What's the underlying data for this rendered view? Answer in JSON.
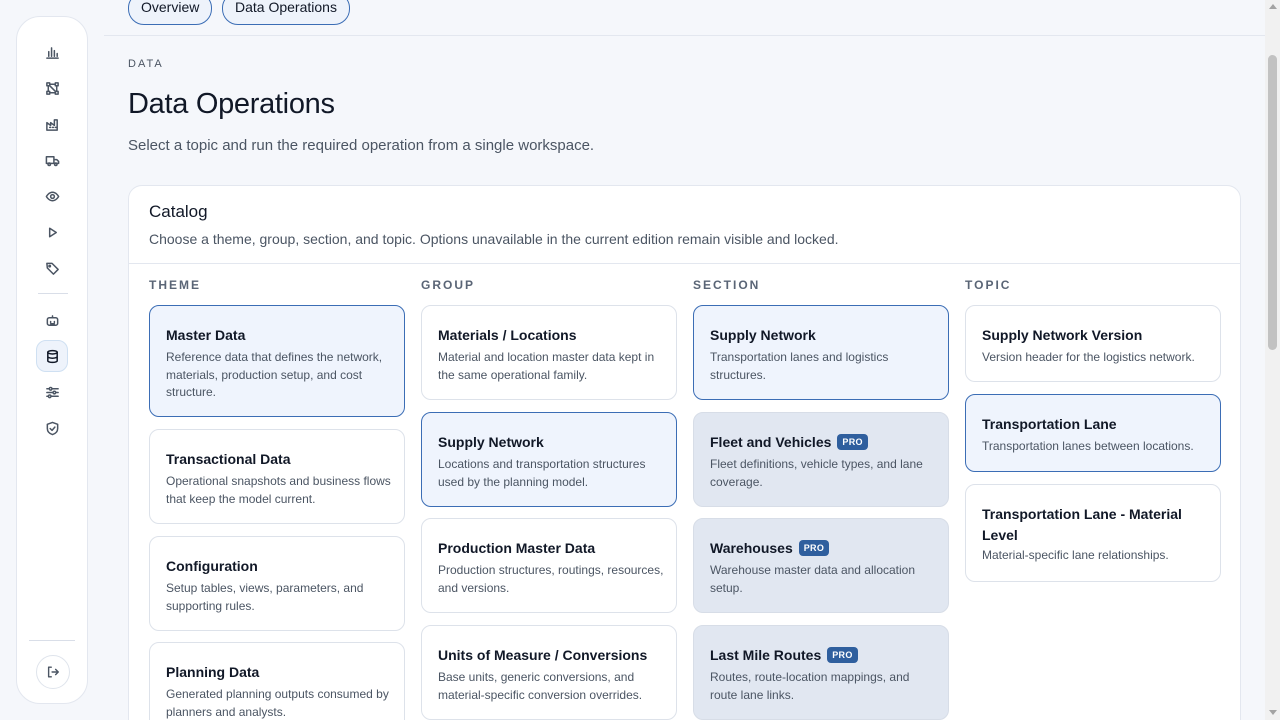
{
  "topbar": {
    "tabs": [
      {
        "label": "Overview"
      },
      {
        "label": "Data Operations"
      }
    ]
  },
  "sidebar": {
    "icons": [
      "bar-chart-icon",
      "network-icon",
      "factory-icon",
      "truck-icon",
      "eye-icon",
      "play-icon",
      "tag-icon",
      "robot-icon",
      "database-icon",
      "sliders-icon",
      "shield-check-icon"
    ],
    "active": "database-icon",
    "logout_icon": "logout-icon"
  },
  "header": {
    "eyebrow": "DATA",
    "title": "Data Operations",
    "subtitle": "Select a topic and run the required operation from a single workspace."
  },
  "catalog": {
    "title": "Catalog",
    "subtitle": "Choose a theme, group, section, and topic. Options unavailable in the current edition remain visible and locked.",
    "pro_badge": "PRO",
    "columns": {
      "theme": {
        "label": "THEME",
        "items": [
          {
            "title": "Master Data",
            "desc": "Reference data that defines the network, materials, production setup, and cost structure."
          },
          {
            "title": "Transactional Data",
            "desc": "Operational snapshots and business flows that keep the model current."
          },
          {
            "title": "Configuration",
            "desc": "Setup tables, views, parameters, and supporting rules."
          },
          {
            "title": "Planning Data",
            "desc": "Generated planning outputs consumed by planners and analysts."
          }
        ]
      },
      "group": {
        "label": "GROUP",
        "items": [
          {
            "title": "Materials / Locations",
            "desc": "Material and location master data kept in the same operational family."
          },
          {
            "title": "Supply Network",
            "desc": "Locations and transportation structures used by the planning model."
          },
          {
            "title": "Production Master Data",
            "desc": "Production structures, routings, resources, and versions."
          },
          {
            "title": "Units of Measure / Conversions",
            "desc": "Base units, generic conversions, and material-specific conversion overrides."
          }
        ]
      },
      "section": {
        "label": "SECTION",
        "items": [
          {
            "title": "Supply Network",
            "desc": "Transportation lanes and logistics structures."
          },
          {
            "title": "Fleet and Vehicles",
            "desc": "Fleet definitions, vehicle types, and lane coverage."
          },
          {
            "title": "Warehouses",
            "desc": "Warehouse master data and allocation setup."
          },
          {
            "title": "Last Mile Routes",
            "desc": "Routes, route-location mappings, and route lane links."
          }
        ]
      },
      "topic": {
        "label": "TOPIC",
        "items": [
          {
            "title": "Supply Network Version",
            "desc": "Version header for the logistics network."
          },
          {
            "title": "Transportation Lane",
            "desc": "Transportation lanes between locations."
          },
          {
            "title": "Transportation Lane - Material Level",
            "desc": "Material-specific lane relationships."
          }
        ]
      }
    }
  },
  "colors": {
    "accent": "#3b6db5",
    "selected_bg": "#eff4fd",
    "locked_bg": "#e1e7f1",
    "badge_bg": "#2f5f9e"
  }
}
